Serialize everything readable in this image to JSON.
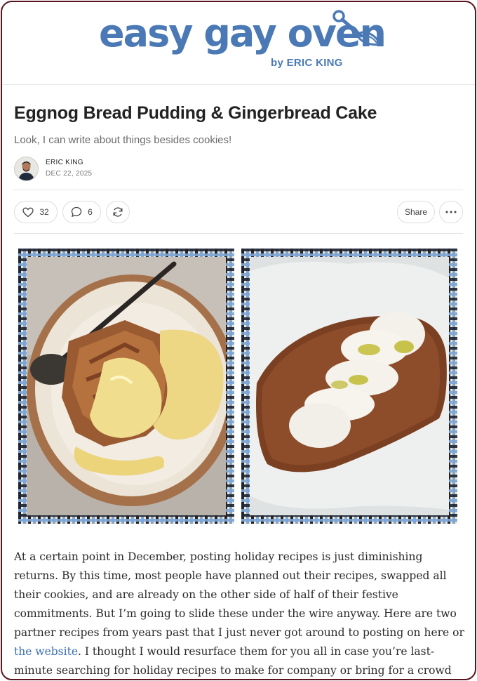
{
  "header": {
    "logo_text": "easy gay oven",
    "logo_byline": "by ERIC KING",
    "brand_color": "#4a79b5"
  },
  "post": {
    "title": "Eggnog Bread Pudding & Gingerbread Cake",
    "subtitle": "Look, I can write about things besides cookies!",
    "author": "ERIC KING",
    "date": "DEC 22, 2025"
  },
  "actions": {
    "like_count": "32",
    "comment_count": "6",
    "share_label": "Share"
  },
  "body": {
    "p1_before_link": "At a certain point in December, posting holiday recipes is just diminishing returns. By this time, most people have planned out their recipes, swapped all their cookies, and are already on the other side of half of their festive commitments. But I’m going to slide these under the wire anyway. Here are two partner recipes from years past that I just never got around to posting on here or ",
    "p1_link": "the website",
    "p1_after_link": ". I thought I would resurface them for you all in case you’re last-minute searching for holiday recipes to make for company or bring for a crowd (that aren’t"
  },
  "icons": [
    "whisk-icon",
    "heart-icon",
    "comment-icon",
    "restack-icon",
    "more-icon"
  ],
  "colors": {
    "frame": "#5a1420",
    "link": "#3b6fb0"
  }
}
